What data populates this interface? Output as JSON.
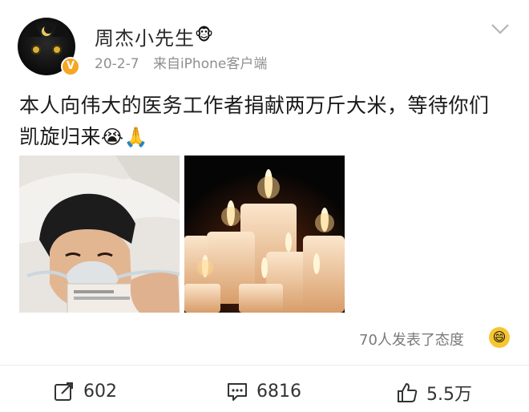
{
  "user": {
    "name": "周杰小先生",
    "badge_icon": "monkey-face-icon",
    "verified_icon": "verified-v-icon",
    "verified_label": "V",
    "timestamp": "20-2-7",
    "source": "来自iPhone客户端"
  },
  "post": {
    "text_line1": "本人向伟大的医务工作者捐献两万斤大米，等待你们",
    "text_line2": "凯旋归来",
    "emojis": [
      "😭",
      "🙏"
    ],
    "images": [
      "hospital-selfie-photo",
      "candles-photo"
    ]
  },
  "reactions": {
    "label": "70人发表了态度",
    "emoji": "😄"
  },
  "actions": {
    "repost_count": "602",
    "comment_count": "6816",
    "like_count": "5.5万"
  },
  "colors": {
    "meta_gray": "#8f8f8f",
    "verified_orange": "#f5a623",
    "reaction_yellow": "#f7c531"
  }
}
